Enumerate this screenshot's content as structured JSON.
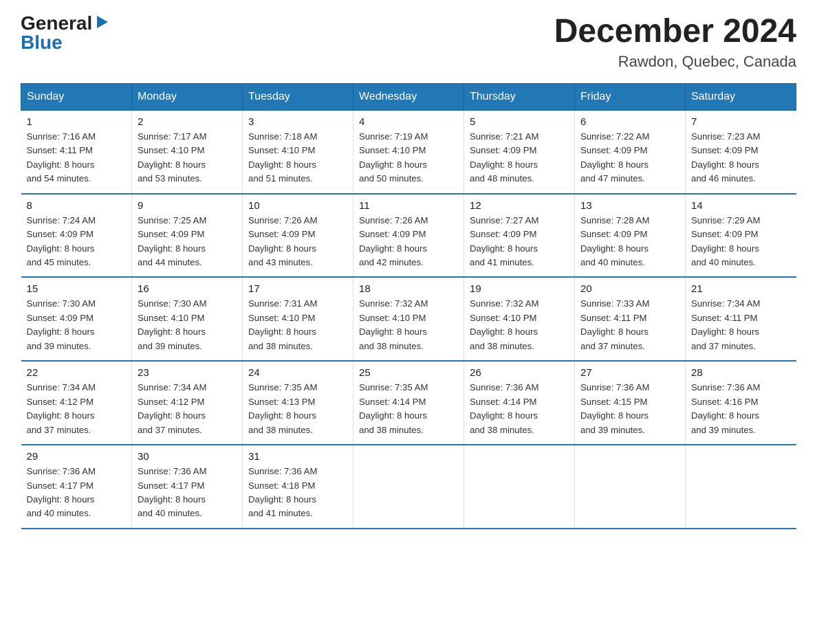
{
  "logo": {
    "general": "General",
    "triangle": "▶",
    "blue": "Blue"
  },
  "title": "December 2024",
  "subtitle": "Rawdon, Quebec, Canada",
  "days_header": [
    "Sunday",
    "Monday",
    "Tuesday",
    "Wednesday",
    "Thursday",
    "Friday",
    "Saturday"
  ],
  "weeks": [
    [
      {
        "day": "1",
        "sunrise": "7:16 AM",
        "sunset": "4:11 PM",
        "daylight": "8 hours and 54 minutes."
      },
      {
        "day": "2",
        "sunrise": "7:17 AM",
        "sunset": "4:10 PM",
        "daylight": "8 hours and 53 minutes."
      },
      {
        "day": "3",
        "sunrise": "7:18 AM",
        "sunset": "4:10 PM",
        "daylight": "8 hours and 51 minutes."
      },
      {
        "day": "4",
        "sunrise": "7:19 AM",
        "sunset": "4:10 PM",
        "daylight": "8 hours and 50 minutes."
      },
      {
        "day": "5",
        "sunrise": "7:21 AM",
        "sunset": "4:09 PM",
        "daylight": "8 hours and 48 minutes."
      },
      {
        "day": "6",
        "sunrise": "7:22 AM",
        "sunset": "4:09 PM",
        "daylight": "8 hours and 47 minutes."
      },
      {
        "day": "7",
        "sunrise": "7:23 AM",
        "sunset": "4:09 PM",
        "daylight": "8 hours and 46 minutes."
      }
    ],
    [
      {
        "day": "8",
        "sunrise": "7:24 AM",
        "sunset": "4:09 PM",
        "daylight": "8 hours and 45 minutes."
      },
      {
        "day": "9",
        "sunrise": "7:25 AM",
        "sunset": "4:09 PM",
        "daylight": "8 hours and 44 minutes."
      },
      {
        "day": "10",
        "sunrise": "7:26 AM",
        "sunset": "4:09 PM",
        "daylight": "8 hours and 43 minutes."
      },
      {
        "day": "11",
        "sunrise": "7:26 AM",
        "sunset": "4:09 PM",
        "daylight": "8 hours and 42 minutes."
      },
      {
        "day": "12",
        "sunrise": "7:27 AM",
        "sunset": "4:09 PM",
        "daylight": "8 hours and 41 minutes."
      },
      {
        "day": "13",
        "sunrise": "7:28 AM",
        "sunset": "4:09 PM",
        "daylight": "8 hours and 40 minutes."
      },
      {
        "day": "14",
        "sunrise": "7:29 AM",
        "sunset": "4:09 PM",
        "daylight": "8 hours and 40 minutes."
      }
    ],
    [
      {
        "day": "15",
        "sunrise": "7:30 AM",
        "sunset": "4:09 PM",
        "daylight": "8 hours and 39 minutes."
      },
      {
        "day": "16",
        "sunrise": "7:30 AM",
        "sunset": "4:10 PM",
        "daylight": "8 hours and 39 minutes."
      },
      {
        "day": "17",
        "sunrise": "7:31 AM",
        "sunset": "4:10 PM",
        "daylight": "8 hours and 38 minutes."
      },
      {
        "day": "18",
        "sunrise": "7:32 AM",
        "sunset": "4:10 PM",
        "daylight": "8 hours and 38 minutes."
      },
      {
        "day": "19",
        "sunrise": "7:32 AM",
        "sunset": "4:10 PM",
        "daylight": "8 hours and 38 minutes."
      },
      {
        "day": "20",
        "sunrise": "7:33 AM",
        "sunset": "4:11 PM",
        "daylight": "8 hours and 37 minutes."
      },
      {
        "day": "21",
        "sunrise": "7:34 AM",
        "sunset": "4:11 PM",
        "daylight": "8 hours and 37 minutes."
      }
    ],
    [
      {
        "day": "22",
        "sunrise": "7:34 AM",
        "sunset": "4:12 PM",
        "daylight": "8 hours and 37 minutes."
      },
      {
        "day": "23",
        "sunrise": "7:34 AM",
        "sunset": "4:12 PM",
        "daylight": "8 hours and 37 minutes."
      },
      {
        "day": "24",
        "sunrise": "7:35 AM",
        "sunset": "4:13 PM",
        "daylight": "8 hours and 38 minutes."
      },
      {
        "day": "25",
        "sunrise": "7:35 AM",
        "sunset": "4:14 PM",
        "daylight": "8 hours and 38 minutes."
      },
      {
        "day": "26",
        "sunrise": "7:36 AM",
        "sunset": "4:14 PM",
        "daylight": "8 hours and 38 minutes."
      },
      {
        "day": "27",
        "sunrise": "7:36 AM",
        "sunset": "4:15 PM",
        "daylight": "8 hours and 39 minutes."
      },
      {
        "day": "28",
        "sunrise": "7:36 AM",
        "sunset": "4:16 PM",
        "daylight": "8 hours and 39 minutes."
      }
    ],
    [
      {
        "day": "29",
        "sunrise": "7:36 AM",
        "sunset": "4:17 PM",
        "daylight": "8 hours and 40 minutes."
      },
      {
        "day": "30",
        "sunrise": "7:36 AM",
        "sunset": "4:17 PM",
        "daylight": "8 hours and 40 minutes."
      },
      {
        "day": "31",
        "sunrise": "7:36 AM",
        "sunset": "4:18 PM",
        "daylight": "8 hours and 41 minutes."
      },
      null,
      null,
      null,
      null
    ]
  ],
  "labels": {
    "sunrise": "Sunrise:",
    "sunset": "Sunset:",
    "daylight": "Daylight:"
  }
}
